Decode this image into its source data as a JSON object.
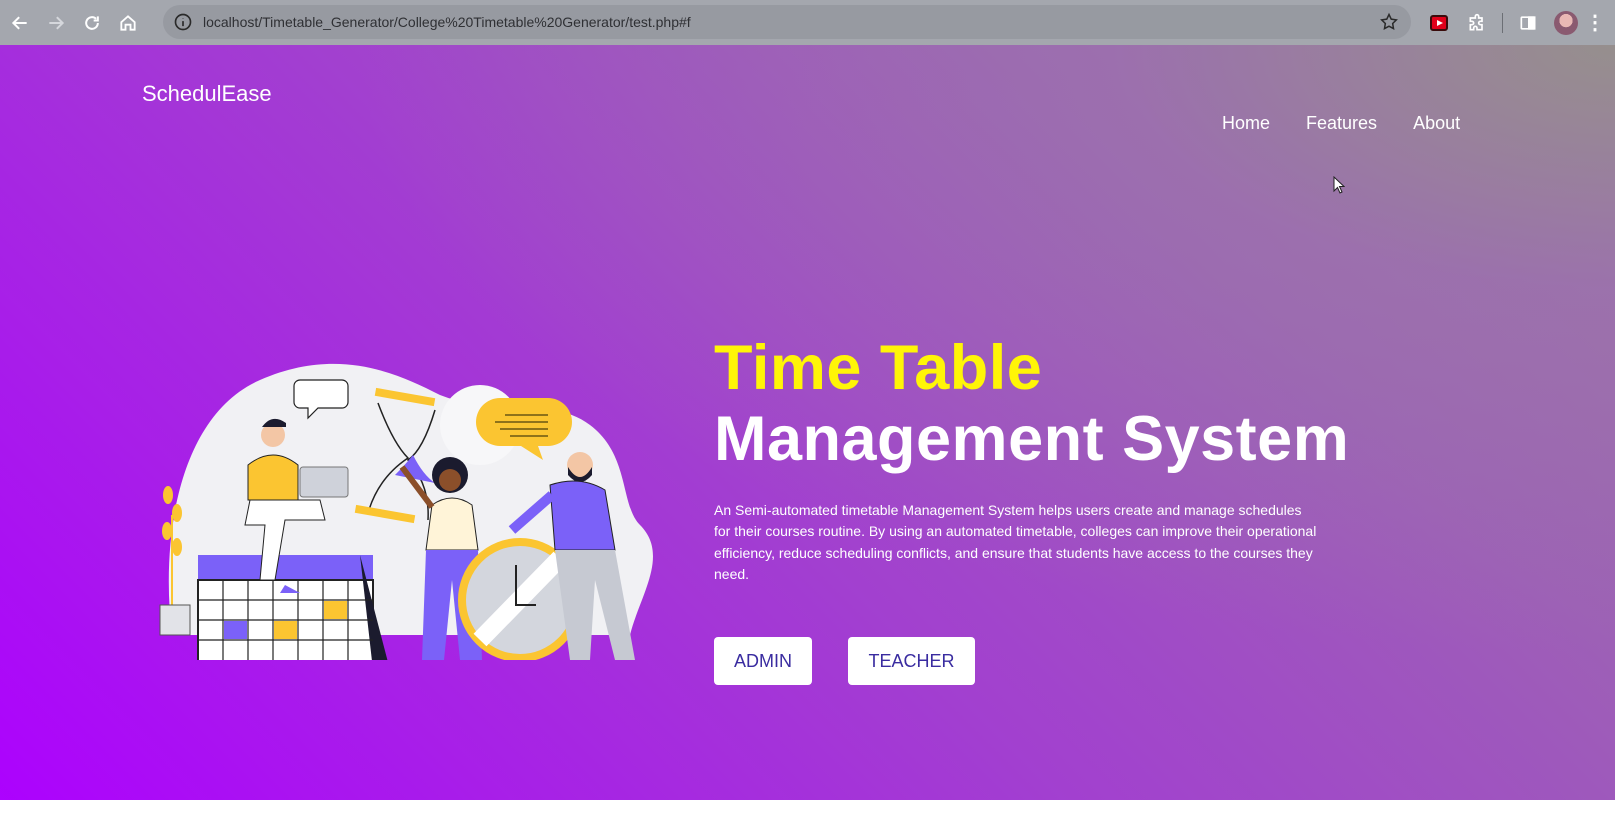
{
  "browser": {
    "url": "localhost/Timetable_Generator/College%20Timetable%20Generator/test.php#f",
    "icons": [
      "back-icon",
      "forward-icon",
      "reload-icon",
      "home-icon",
      "site-info-icon",
      "bookmark-star-icon",
      "youtube-extension-icon",
      "extensions-puzzle-icon",
      "side-panel-icon",
      "profile-avatar",
      "more-menu-icon"
    ]
  },
  "navbar": {
    "brand": "SchedulEase",
    "links": [
      "Home",
      "Features",
      "About"
    ]
  },
  "hero": {
    "title_line1": "Time Table",
    "title_line2": "Management System",
    "description": "An Semi-automated timetable Management System helps users create and manage schedules for their courses routine. By using an automated timetable, colleges can improve their operational efficiency, reduce scheduling conflicts, and ensure that students have access to the courses they need.",
    "buttons": {
      "admin": "ADMIN",
      "teacher": "TEACHER"
    }
  },
  "colors": {
    "title_accent": "#fff507",
    "gradient_start": "#ad00ff",
    "gradient_end": "#9b6ea8",
    "button_text": "#3a2ca0",
    "illustration_purple": "#7b61f8",
    "illustration_yellow": "#fbc531"
  }
}
